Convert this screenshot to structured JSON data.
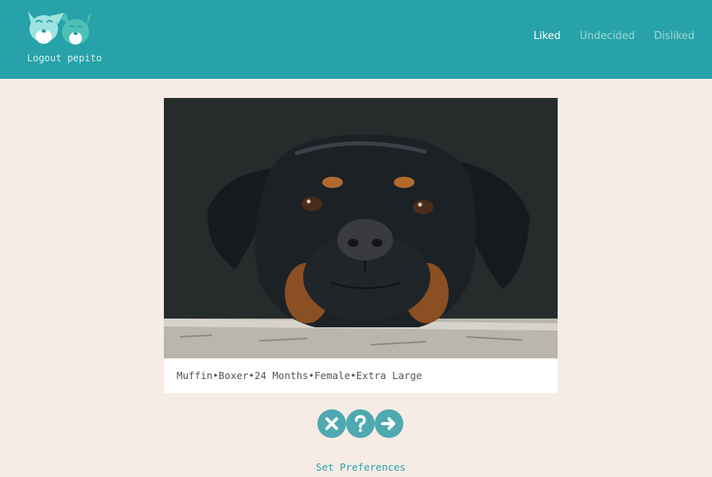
{
  "header": {
    "logo_icon": "two-dogs-logo-icon",
    "logout_label": "Logout pepito",
    "nav": {
      "liked": "Liked",
      "undecided": "Undecided",
      "disliked": "Disliked"
    },
    "active_tab": "Liked",
    "bg_color": "#27a2a8"
  },
  "card": {
    "photo_alt": "Rottweiler resting head on stone ledge",
    "caption": "Muffin•Boxer•24 Months•Female•Extra Large"
  },
  "actions": {
    "dislike_icon": "close-icon",
    "undecided_icon": "question-icon",
    "like_icon": "arrow-right-icon",
    "button_color": "#4fa9b0"
  },
  "footer": {
    "preferences_link": "Set Preferences"
  }
}
